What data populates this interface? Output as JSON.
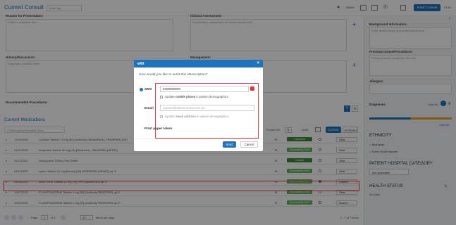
{
  "header": {
    "title": "Current Consult",
    "tag_placeholder": "Enter tag",
    "gmas_label": "GMAS",
    "finish_label": "Finish Consult",
    "time": "07:16"
  },
  "notes": {
    "presentation_label": "Reason for Presentation:",
    "presentation_placeholder": "Patient complaints here",
    "clinical_label": "Clinical Assessment:",
    "clinical_placeholder": "Examination, assessment of current issues here",
    "history_label": "History/Discussion:",
    "history_placeholder": "Diagnosis, condition here",
    "management_label": "Management:",
    "procedures_label": "Recommended Procedures:"
  },
  "medications": {
    "title": "Current Medications",
    "search_placeholder": "Start typing Favourite items",
    "expand_label": "Expand All",
    "audit_label": "Audit",
    "current_tab": "Current",
    "archived_tab": "Archived",
    "rows": [
      {
        "date": "17/02/2022",
        "name": "Constan Tablets 7.5 mg [60] (Authority (StreamNext)- PBS/RPBS) (AP)",
        "status": "Cancelled",
        "view": "View",
        "success": false
      },
      {
        "date": "24/01/2022",
        "name": "Anaprazin Tablets 30 mg [15] (Restricted - PBS/RPBS (NPHP))",
        "status": "Successfully Sent",
        "view": "View",
        "success": true
      },
      {
        "date": "11/11/2022",
        "name": "Doxycycline 100mg Oral Tablet",
        "status": "Ceased",
        "view": "View",
        "success": false
      },
      {
        "date": "01/11/2022",
        "name": "Lipitor Tablets 10 mg (Breast) [30] (PBS/RPBS (NP/NP)) qd: 5",
        "status": "Successfully Sent",
        "view": "View",
        "success": true
      },
      {
        "date": "01/09/2022",
        "name": "ADEFOVIR Tablets 10 mg [30] (PBS (active/100) qd: 5",
        "status": "Successfully Sent",
        "view": "Amend",
        "success": true
      },
      {
        "date": "10/07/2022",
        "name": "FLUNITRAZEPAM Tablets 1 mg [30] (Authority PBS/RPBS) qd: 5",
        "status": "Successfully Sent",
        "view": "View",
        "success": true
      },
      {
        "date": "10/07/2022",
        "name": "FLUNITRAZEPAM Tablets 1 mg [30] (Authority PBS/RPBS) qd: 5",
        "status": "Successfully Sent",
        "view": "Amend",
        "success": true
      }
    ],
    "pager": {
      "page_label": "Page",
      "page": "1",
      "of": "of 1",
      "per_page": "10",
      "items_label": "items per page",
      "summary": "1 - 7 of 7 items"
    }
  },
  "right_panel": {
    "background_label": "Background Information:",
    "background_placeholder": "Enter family history and social history here",
    "previous_label": "Previous Issues/Procedures:",
    "previous_placeholder": "Previous issues, surgeries, etc here",
    "allergies_label": "Allergies:",
    "diagnoses_label": "Diagnoses",
    "view_all": "View All",
    "ethnicity_label": "ETHNICITY",
    "ethnicity_options": [
      "Aboriginal",
      "Torres Strait Islander"
    ],
    "hospital_label": "PATIENT HOSPITAL CATEGORY",
    "hospital_value": "Not applicable",
    "health_label": "HEALTH STATUS",
    "health_value": "No Data"
  },
  "modal": {
    "title": "eRX",
    "question": "How would you like to send this eRescription?",
    "sms_label": "SMS",
    "phone_value": "0400000000",
    "update_mobile_pre": "Update ",
    "update_mobile_bold": "mobile phone",
    "update_mobile_post": " in patient demographics",
    "email_label": "Email",
    "email_placeholder": "nquach@directcontrol.com.au",
    "update_email_pre": "Update ",
    "update_email_bold": "email address",
    "update_email_post": " in patient demographics",
    "print_label": "Print paper token",
    "send_label": "Send",
    "cancel_label": "Cancel"
  },
  "colors": {
    "accent": "#1e73be",
    "success": "#5cb85c",
    "highlight": "#e3343a"
  }
}
